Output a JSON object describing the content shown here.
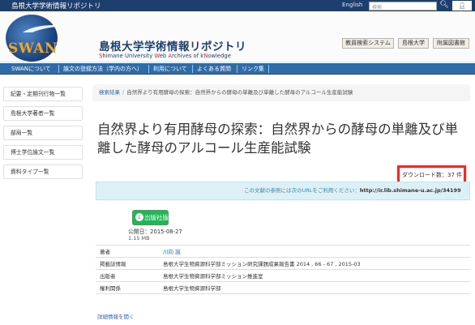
{
  "topbar": {
    "site_name": "島根大学学術情報リポジトリ",
    "lang_label": "English",
    "search_placeholder": "検索",
    "login_label": "ログイン"
  },
  "header": {
    "logo_text": "SWAN",
    "title_jp": "島根大学学術情報リポジトリ",
    "title_en_parts": [
      "S",
      "himane University ",
      "W",
      "eb ",
      "A",
      "rchives of k",
      "N",
      "owledge"
    ],
    "buttons": [
      "教員検索システム",
      "島根大学",
      "附属図書館"
    ]
  },
  "nav": {
    "items": [
      "SWANについて",
      "論文の登録方法（学内の方へ）",
      "利用について",
      "よくある質問",
      "リンク集"
    ]
  },
  "sidebar": {
    "items": [
      "紀要・定期刊行物一覧",
      "島根大学著者一覧",
      "部局一覧",
      "博士学位論文一覧",
      "資料タイプ一覧"
    ]
  },
  "breadcrumb": {
    "root": "検索結果",
    "current": "自然界より有用酵母の探索：自然界からの酵母の単離及び単離した酵母のアルコール生産能試験"
  },
  "item": {
    "title": "自然界より有用酵母の探索：自然界からの酵母の単離及び単離した酵母のアルコール生産能試験",
    "download_count": "ダウンロード数：37 件",
    "info_text": "この文献の参照には次のURLをご利用ください：",
    "info_url": "http://ir.lib.shimane-u.ac.jp/34199",
    "pdf_label": "出版社版PDF",
    "published": "公開日：2015-08-27",
    "file_size": "1.15 MB",
    "meta": [
      {
        "key": "著者",
        "value": "川向 誠",
        "link": true
      },
      {
        "key": "掲載誌情報",
        "value": "島根大学生物資源科学部ミッション研究課題成果報告書 2014 , 66 - 67 , 2015-03",
        "link": false
      },
      {
        "key": "出版者",
        "value": "島根大学生物資源科学部ミッション推進室",
        "link": false
      },
      {
        "key": "権利関係",
        "value": "島根大学生物資源科学部",
        "link": false
      }
    ],
    "more_link": "詳細情報を開く"
  },
  "colors": {
    "topbar": "#1d3f6f",
    "navbar": "#2e6ba7",
    "pdf_button": "#23b455",
    "highlight_box": "#e52f2f"
  },
  "icons": {
    "search": "search-icon",
    "pdf": "download-icon"
  }
}
